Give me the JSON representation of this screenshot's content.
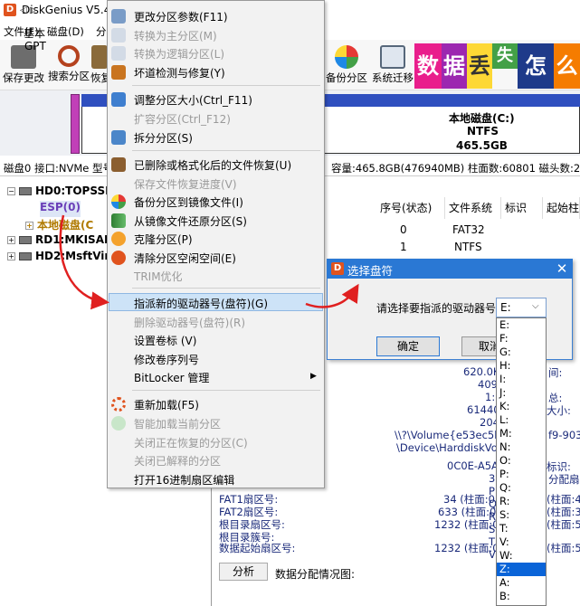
{
  "window": {
    "title": "DiskGenius V5.4.0"
  },
  "menubar": {
    "items": [
      "文件(F)",
      "磁盘(D)",
      "分"
    ]
  },
  "toolbar": {
    "buttons": [
      {
        "label": "保存更改",
        "icon": "save-icon"
      },
      {
        "label": "搜索分区",
        "icon": "search-icon"
      },
      {
        "label": "恢复",
        "icon": "recover-icon"
      },
      {
        "label": "备份分区",
        "icon": "backup-icon"
      },
      {
        "label": "系统迁移",
        "icon": "migrate-icon"
      }
    ],
    "banner": [
      "数",
      "据",
      "丢",
      "失",
      "怎",
      "么"
    ]
  },
  "diskstrip": {
    "nav": "◁ ▷",
    "disk_type_line1": "基本",
    "disk_type_line2": "GPT",
    "partition_name": "本地磁盘(C:)",
    "partition_fs": "NTFS",
    "partition_size": "465.5GB"
  },
  "infoline": {
    "left": "磁盘0 接口:NVMe  型号",
    "right": "容量:465.8GB(476940MB)  柱面数:60801  磁头数:255"
  },
  "tree": {
    "items": [
      {
        "text": "HD0:TOPSSD",
        "level": 0
      },
      {
        "text": "ESP(0)",
        "level": 1
      },
      {
        "text": "本地磁盘(C",
        "level": 1
      },
      {
        "text": "RD1:MKISAM",
        "level": 0
      },
      {
        "text": "HD2:MsftVir",
        "level": 0
      }
    ]
  },
  "table": {
    "headers": [
      "序号(状态)",
      "文件系统",
      "标识",
      "起始柱"
    ],
    "rows": [
      {
        "index": "0",
        "fs": "FAT32"
      },
      {
        "index": "1",
        "fs": "NTFS"
      }
    ]
  },
  "details": {
    "values_right": [
      "620.0K",
      "409",
      "1:",
      "61440",
      "204",
      "\\\\?\\Volume{e53ec5b",
      "\\Device\\HarddiskVol",
      "0C0E-A5A",
      "3",
      "P",
      "Q",
      "R",
      "S",
      "T",
      "V"
    ],
    "labels_far": [
      "间:",
      "总:",
      "大小:",
      "f9-9036",
      "标识:",
      "分配扇区",
      "(柱面:4)",
      "(柱面:36)",
      "(柱面:5)",
      "(柱面:5)"
    ],
    "fat_rows": [
      {
        "label": "FAT1扇区号:",
        "value": "34 (柱面:0"
      },
      {
        "label": "FAT2扇区号:",
        "value": "633 (柱面:0"
      },
      {
        "label": "根目录扇区号:",
        "value": "1232 (柱面:0"
      },
      {
        "label": "根目录簇号:",
        "value": ""
      },
      {
        "label": "数据起始扇区号:",
        "value": "1232 (柱面:0"
      }
    ],
    "analyze_button": "分析",
    "analyze_label": "数据分配情况图:"
  },
  "context_menu": {
    "items": [
      {
        "label": "更改分区参数(F11)",
        "disabled": false,
        "icon": "edit-icon"
      },
      {
        "label": "转换为主分区(M)",
        "disabled": true,
        "icon": "convert-primary-icon"
      },
      {
        "label": "转换为逻辑分区(L)",
        "disabled": true,
        "icon": "convert-logical-icon"
      },
      {
        "label": "坏道检测与修复(Y)",
        "disabled": false,
        "icon": "tools-icon"
      },
      {
        "label": "调整分区大小(Ctrl_F11)",
        "disabled": false,
        "icon": "resize-icon"
      },
      {
        "label": "扩容分区(Ctrl_F12)",
        "disabled": true,
        "icon": ""
      },
      {
        "label": "拆分分区(S)",
        "disabled": false,
        "icon": "split-icon"
      },
      {
        "label": "已删除或格式化后的文件恢复(U)",
        "disabled": false,
        "icon": "recover-file-icon"
      },
      {
        "label": "保存文件恢复进度(V)",
        "disabled": true,
        "icon": ""
      },
      {
        "label": "备份分区到镜像文件(I)",
        "disabled": false,
        "icon": "backup-image-icon"
      },
      {
        "label": "从镜像文件还原分区(S)",
        "disabled": false,
        "icon": "restore-image-icon"
      },
      {
        "label": "克隆分区(P)",
        "disabled": false,
        "icon": "clone-icon"
      },
      {
        "label": "清除分区空闲空间(E)",
        "disabled": false,
        "icon": "wipe-icon"
      },
      {
        "label": "TRIM优化",
        "disabled": true,
        "icon": ""
      },
      {
        "label": "指派新的驱动器号(盘符)(G)",
        "disabled": false,
        "icon": "",
        "highlighted": true
      },
      {
        "label": "删除驱动器号(盘符)(R)",
        "disabled": true,
        "icon": ""
      },
      {
        "label": "设置卷标 (V)",
        "disabled": false,
        "icon": ""
      },
      {
        "label": "修改卷序列号",
        "disabled": false,
        "icon": ""
      },
      {
        "label": "BitLocker 管理",
        "disabled": false,
        "icon": "",
        "submenu": true
      },
      {
        "label": "重新加载(F5)",
        "disabled": false,
        "icon": "reload-icon"
      },
      {
        "label": "智能加载当前分区",
        "disabled": true,
        "icon": "smart-load-icon"
      },
      {
        "label": "关闭正在恢复的分区(C)",
        "disabled": true,
        "icon": ""
      },
      {
        "label": "关闭已解释的分区",
        "disabled": true,
        "icon": ""
      },
      {
        "label": "打开16进制扇区编辑",
        "disabled": false,
        "icon": ""
      }
    ],
    "submenu_arrow": "▶"
  },
  "dialog": {
    "title": "选择盘符",
    "prompt": "请选择要指派的驱动器号:",
    "selected": "E:",
    "ok": "确定",
    "cancel": "取消",
    "close": "✕"
  },
  "dropdown": {
    "options": [
      "E:",
      "F:",
      "G:",
      "H:",
      "I:",
      "J:",
      "K:",
      "L:",
      "M:",
      "N:",
      "O:",
      "P:",
      "Q:",
      "R:",
      "S:",
      "T:",
      "V:",
      "W:",
      "Z:",
      "A:",
      "B:"
    ],
    "selected_option": "Z:"
  },
  "colors": {
    "accent": "#2a78d4",
    "highlight": "#cde3f7",
    "arrow": "#e02020",
    "esp": "#c13fb8"
  }
}
